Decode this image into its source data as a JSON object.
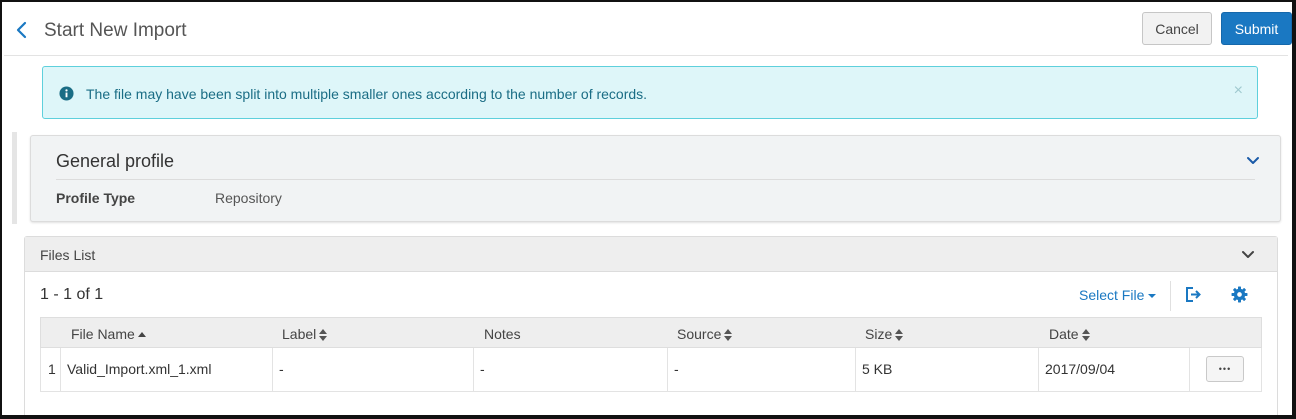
{
  "header": {
    "title": "Start New Import",
    "cancel_label": "Cancel",
    "submit_label": "Submit",
    "back_icon": "chevron-left-icon"
  },
  "alert": {
    "icon": "info-icon",
    "message": "The file may have been split into multiple smaller ones according to the number of records.",
    "close_glyph": "×"
  },
  "general_profile": {
    "title": "General profile",
    "fields": [
      {
        "label": "Profile Type",
        "value": "Repository"
      }
    ]
  },
  "files_list": {
    "title": "Files List",
    "record_count": "1 - 1 of 1",
    "select_file_label": "Select File",
    "columns": [
      "File Name",
      "Label",
      "Notes",
      "Source",
      "Size",
      "Date"
    ],
    "rows": [
      {
        "index": "1",
        "file_name": "Valid_Import.xml_1.xml",
        "label": "-",
        "notes": "-",
        "source": "-",
        "size": "5 KB",
        "date": "2017/09/04",
        "actions_glyph": "•••"
      }
    ]
  },
  "colors": {
    "accent": "#1a78c2",
    "alert_bg": "#def6f9",
    "alert_border": "#5ed0dc",
    "alert_text": "#1a6d85"
  }
}
